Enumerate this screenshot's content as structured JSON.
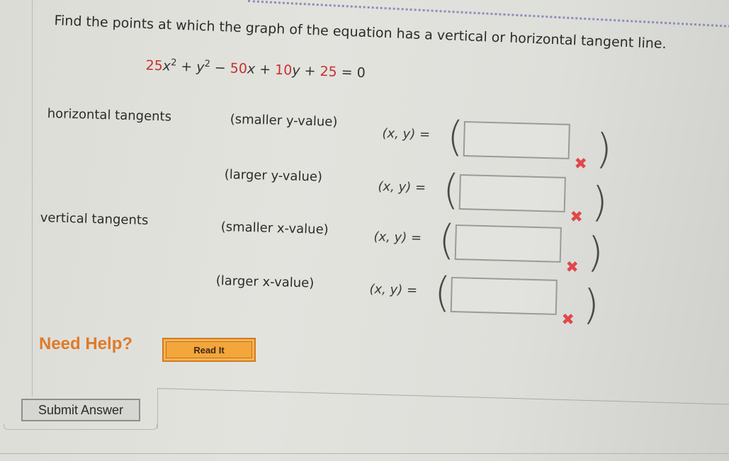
{
  "question": {
    "prompt": "Find the points at which the graph of the equation has a vertical or horizontal tangent line.",
    "equation": {
      "c1": "25",
      "v1": "x",
      "e1": "2",
      "op1": " + ",
      "v2": "y",
      "e2": "2",
      "op2": " − ",
      "c3": "50",
      "v3": "x",
      "op3": " + ",
      "c4": "10",
      "v4": "y",
      "op4": " + ",
      "c5": "25",
      "rhs": " = 0"
    }
  },
  "sections": {
    "horizontal": "horizontal tangents",
    "vertical": "vertical tangents"
  },
  "rows": [
    {
      "label": "(smaller y-value)",
      "xy": "(x, y) =",
      "value": "",
      "status": "incorrect",
      "mark": "✖"
    },
    {
      "label": "(larger y-value)",
      "xy": "(x, y) =",
      "value": "",
      "status": "incorrect",
      "mark": "✖"
    },
    {
      "label": "(smaller x-value)",
      "xy": "(x, y) =",
      "value": "",
      "status": "incorrect",
      "mark": "✖"
    },
    {
      "label": "(larger x-value)",
      "xy": "(x, y) =",
      "value": "",
      "status": "incorrect",
      "mark": "✖"
    }
  ],
  "parens": {
    "open": "(",
    "close": ")"
  },
  "help": {
    "label": "Need Help?",
    "read_it": "Read It"
  },
  "submit_label": "Submit Answer",
  "colors": {
    "help_orange": "#e07a2a",
    "button_orange": "#f3a63b",
    "incorrect_red": "#e0474a",
    "equation_red": "#c8322e"
  }
}
